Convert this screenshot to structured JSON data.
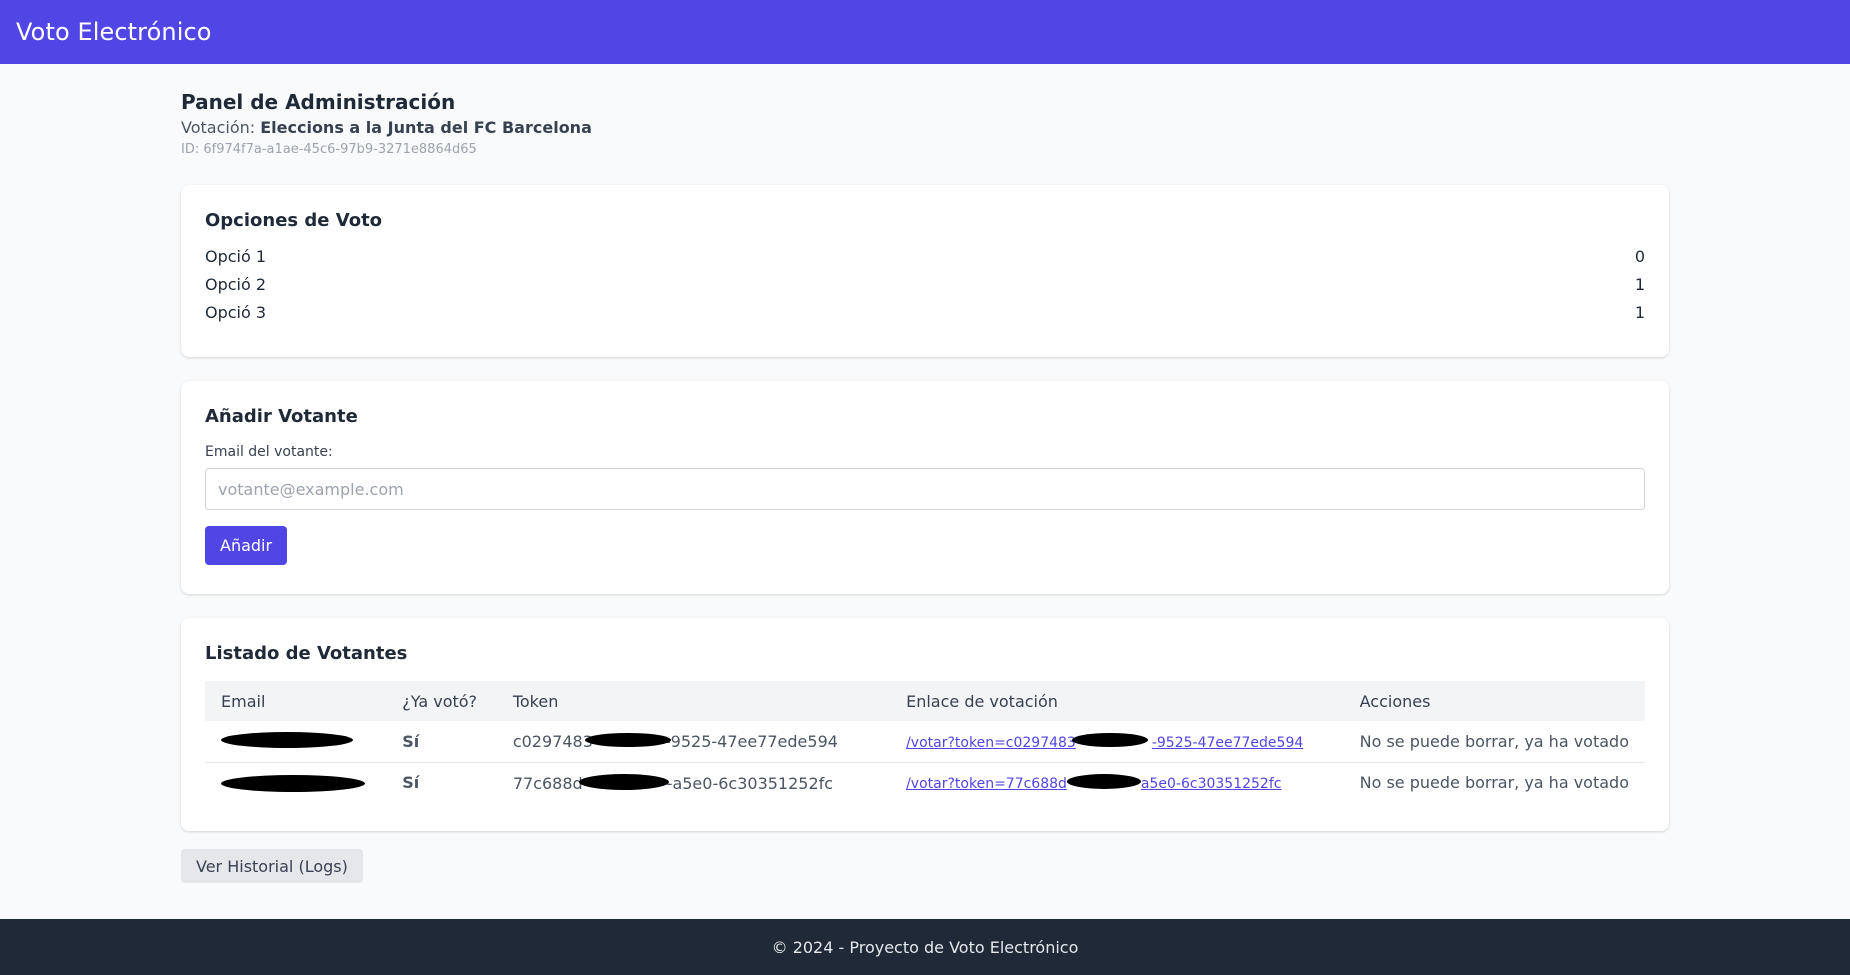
{
  "navbar": {
    "brand": "Voto Electrónico"
  },
  "header": {
    "title": "Panel de Administración",
    "vote_prefix": "Votación: ",
    "vote_name": "Eleccions a la Junta del FC Barcelona",
    "vote_id": "ID: 6f974f7a-a1ae-45c6-97b9-3271e8864d65"
  },
  "options_card": {
    "title": "Opciones de Voto",
    "options": [
      {
        "label": "Opció 1",
        "count": "0"
      },
      {
        "label": "Opció 2",
        "count": "1"
      },
      {
        "label": "Opció 3",
        "count": "1"
      }
    ]
  },
  "add_voter": {
    "title": "Añadir Votante",
    "email_label": "Email del votante:",
    "email_placeholder": "votante@example.com",
    "email_value": "",
    "button_label": "Añadir"
  },
  "voters": {
    "title": "Listado de Votantes",
    "columns": [
      "Email",
      "¿Ya votó?",
      "Token",
      "Enlace de votación",
      "Acciones"
    ],
    "rows": [
      {
        "email": "",
        "voted": "Sí",
        "token_start": "c0297483",
        "token_end": "-9525-47ee77ede594",
        "link_start": "/votar?token=c0297483",
        "link_end": "-9525-47ee77ede594",
        "action": "No se puede borrar, ya ha votado"
      },
      {
        "email": "",
        "voted": "Sí",
        "token_start": "77c688d",
        "token_end": "-a5e0-6c30351252fc",
        "link_start": "/votar?token=77c688d",
        "link_end": "a5e0-6c30351252fc",
        "action": "No se puede borrar, ya ha votado"
      }
    ]
  },
  "logs_button_label": "Ver Historial (Logs)",
  "footer": {
    "text": "© 2024 - Proyecto de Voto Electrónico"
  },
  "colors": {
    "primary": "#4f46e5",
    "footer_bg": "#1f2937",
    "success": "#16a34a"
  }
}
